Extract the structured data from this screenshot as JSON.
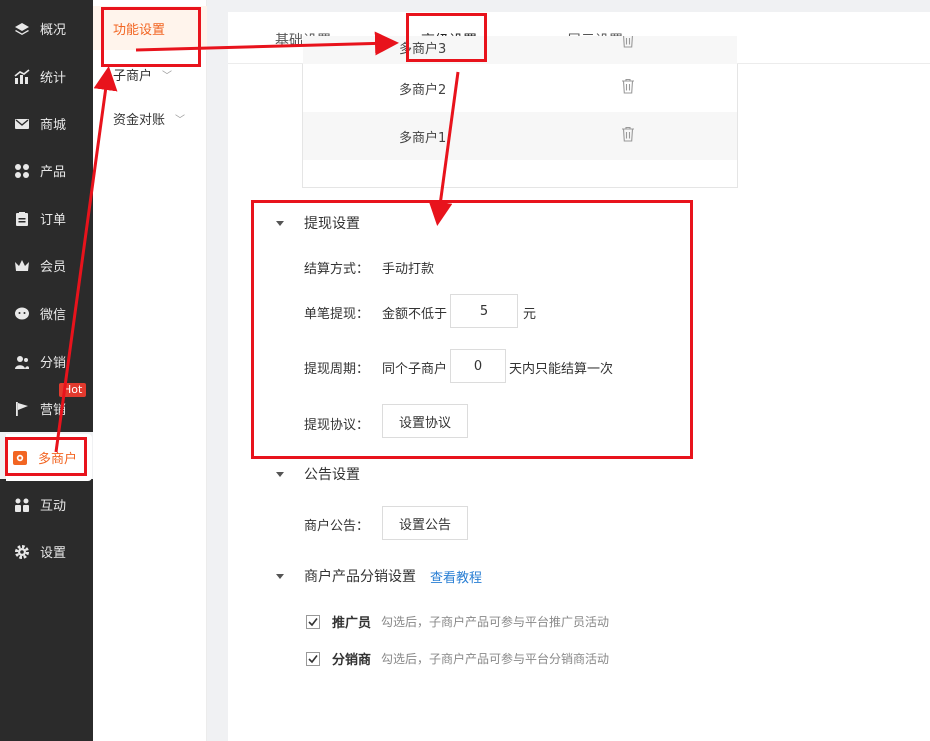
{
  "sidebar": {
    "items": [
      {
        "label": "概况",
        "icon": "layers-icon"
      },
      {
        "label": "统计",
        "icon": "bar-chart-icon"
      },
      {
        "label": "商城",
        "icon": "mail-icon"
      },
      {
        "label": "产品",
        "icon": "grid-icon"
      },
      {
        "label": "订单",
        "icon": "order-icon"
      },
      {
        "label": "会员",
        "icon": "crown-icon"
      },
      {
        "label": "微信",
        "icon": "wechat-icon"
      },
      {
        "label": "分销",
        "icon": "users-icon"
      },
      {
        "label": "营销",
        "icon": "flag-icon"
      },
      {
        "label": "多商户",
        "icon": "multi-store-icon"
      },
      {
        "label": "互动",
        "icon": "interact-icon"
      },
      {
        "label": "设置",
        "icon": "gear-icon"
      }
    ],
    "hot_badge": "Hot"
  },
  "subnav": {
    "items": [
      {
        "label": "功能设置"
      },
      {
        "label": "子商户"
      },
      {
        "label": "资金对账"
      }
    ]
  },
  "tabs": {
    "items": [
      {
        "label": "基础设置"
      },
      {
        "label": "高级设置"
      },
      {
        "label": "展示设置"
      }
    ]
  },
  "merchant_list": {
    "rows": [
      {
        "name": "多商户3"
      },
      {
        "name": "多商户2"
      },
      {
        "name": "多商户1"
      }
    ]
  },
  "withdraw": {
    "title": "提现设置",
    "settle_label": "结算方式：",
    "settle_value": "手动打款",
    "single_label": "单笔提现：",
    "single_prefix": "金额不低于",
    "single_value": "5",
    "single_unit": "元",
    "period_label": "提现周期：",
    "period_prefix": "同个子商户",
    "period_value": "0",
    "period_suffix": "天内只能结算一次",
    "agreement_label": "提现协议：",
    "agreement_button": "设置协议"
  },
  "notice": {
    "title": "公告设置",
    "label": "商户公告：",
    "button": "设置公告"
  },
  "distribution": {
    "title": "商户产品分销设置",
    "tutorial_link": "查看教程",
    "options": [
      {
        "label": "推广员",
        "hint": "勾选后，子商户产品可参与平台推广员活动",
        "checked": true
      },
      {
        "label": "分销商",
        "hint": "勾选后，子商户产品可参与平台分销商活动",
        "checked": true
      }
    ]
  },
  "colors": {
    "accent": "#f26522",
    "annotation": "#e8131c",
    "link": "#2a7fd4",
    "sidebar_bg": "#2b2b2b"
  }
}
